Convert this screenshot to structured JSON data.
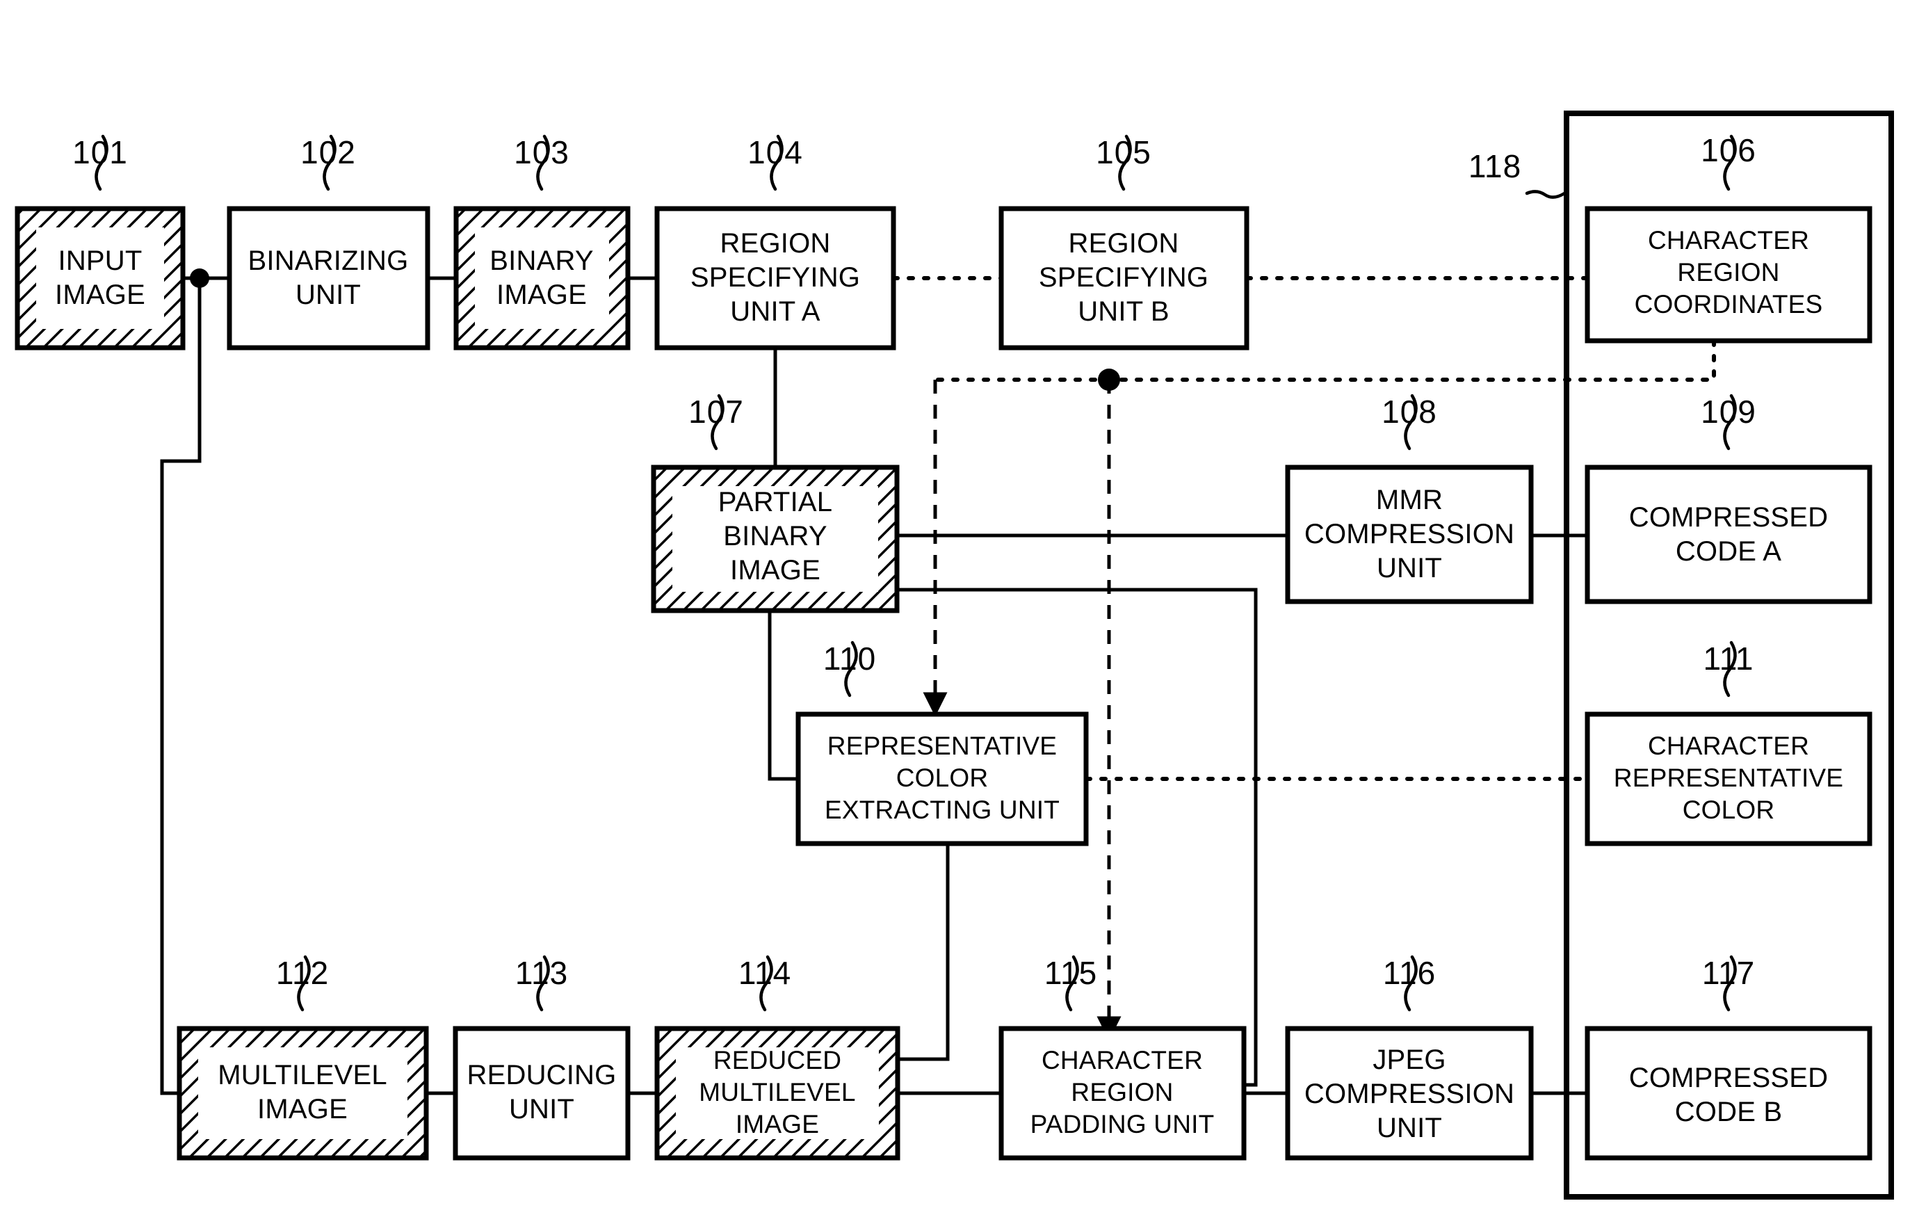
{
  "figure": {
    "kind": "block-diagram",
    "background": "#ffffff",
    "ink_color": "#000000"
  },
  "container": {
    "ref": "118",
    "name": "compressed-data-container"
  },
  "blocks": [
    {
      "ref": "101",
      "lines": [
        "INPUT",
        "IMAGE"
      ],
      "style": "hatched"
    },
    {
      "ref": "102",
      "lines": [
        "BINARIZING",
        "UNIT"
      ],
      "style": "plain"
    },
    {
      "ref": "103",
      "lines": [
        "BINARY",
        "IMAGE"
      ],
      "style": "hatched"
    },
    {
      "ref": "104",
      "lines": [
        "REGION",
        "SPECIFYING",
        "UNIT A"
      ],
      "style": "plain"
    },
    {
      "ref": "105",
      "lines": [
        "REGION",
        "SPECIFYING",
        "UNIT B"
      ],
      "style": "plain"
    },
    {
      "ref": "106",
      "lines": [
        "CHARACTER",
        "REGION",
        "COORDINATES"
      ],
      "style": "plain"
    },
    {
      "ref": "107",
      "lines": [
        "PARTIAL",
        "BINARY",
        "IMAGE"
      ],
      "style": "hatched"
    },
    {
      "ref": "108",
      "lines": [
        "MMR",
        "COMPRESSION",
        "UNIT"
      ],
      "style": "plain"
    },
    {
      "ref": "109",
      "lines": [
        "COMPRESSED",
        "CODE A"
      ],
      "style": "plain"
    },
    {
      "ref": "110",
      "lines": [
        "REPRESENTATIVE",
        "COLOR",
        "EXTRACTING UNIT"
      ],
      "style": "plain"
    },
    {
      "ref": "111",
      "lines": [
        "CHARACTER",
        "REPRESENTATIVE",
        "COLOR"
      ],
      "style": "plain"
    },
    {
      "ref": "112",
      "lines": [
        "MULTILEVEL",
        "IMAGE"
      ],
      "style": "hatched"
    },
    {
      "ref": "113",
      "lines": [
        "REDUCING",
        "UNIT"
      ],
      "style": "plain"
    },
    {
      "ref": "114",
      "lines": [
        "REDUCED",
        "MULTILEVEL",
        "IMAGE"
      ],
      "style": "hatched"
    },
    {
      "ref": "115",
      "lines": [
        "CHARACTER",
        "REGION",
        "PADDING UNIT"
      ],
      "style": "plain"
    },
    {
      "ref": "116",
      "lines": [
        "JPEG",
        "COMPRESSION",
        "UNIT"
      ],
      "style": "plain"
    },
    {
      "ref": "117",
      "lines": [
        "COMPRESSED",
        "CODE B"
      ],
      "style": "plain"
    }
  ],
  "b": {
    "101": {
      "l0": "INPUT",
      "l1": "IMAGE",
      "l2": "",
      "n": "101"
    },
    "102": {
      "l0": "BINARIZING",
      "l1": "UNIT",
      "l2": "",
      "n": "102"
    },
    "103": {
      "l0": "BINARY",
      "l1": "IMAGE",
      "l2": "",
      "n": "103"
    },
    "104": {
      "l0": "REGION",
      "l1": "SPECIFYING",
      "l2": "UNIT A",
      "n": "104"
    },
    "105": {
      "l0": "REGION",
      "l1": "SPECIFYING",
      "l2": "UNIT B",
      "n": "105"
    },
    "106": {
      "l0": "CHARACTER",
      "l1": "REGION",
      "l2": "COORDINATES",
      "n": "106"
    },
    "107": {
      "l0": "PARTIAL",
      "l1": "BINARY",
      "l2": "IMAGE",
      "n": "107"
    },
    "108": {
      "l0": "MMR",
      "l1": "COMPRESSION",
      "l2": "UNIT",
      "n": "108"
    },
    "109": {
      "l0": "COMPRESSED",
      "l1": "CODE A",
      "l2": "",
      "n": "109"
    },
    "110": {
      "l0": "REPRESENTATIVE",
      "l1": "COLOR",
      "l2": "EXTRACTING UNIT",
      "n": "110"
    },
    "111": {
      "l0": "CHARACTER",
      "l1": "REPRESENTATIVE",
      "l2": "COLOR",
      "n": "111"
    },
    "112": {
      "l0": "MULTILEVEL",
      "l1": "IMAGE",
      "l2": "",
      "n": "112"
    },
    "113": {
      "l0": "REDUCING",
      "l1": "UNIT",
      "l2": "",
      "n": "113"
    },
    "114": {
      "l0": "REDUCED",
      "l1": "MULTILEVEL",
      "l2": "IMAGE",
      "n": "114"
    },
    "115": {
      "l0": "CHARACTER",
      "l1": "REGION",
      "l2": "PADDING UNIT",
      "n": "115"
    },
    "116": {
      "l0": "JPEG",
      "l1": "COMPRESSION",
      "l2": "UNIT",
      "n": "116"
    },
    "117": {
      "l0": "COMPRESSED",
      "l1": "CODE B",
      "l2": "",
      "n": "117"
    },
    "118": {
      "n": "118"
    }
  }
}
